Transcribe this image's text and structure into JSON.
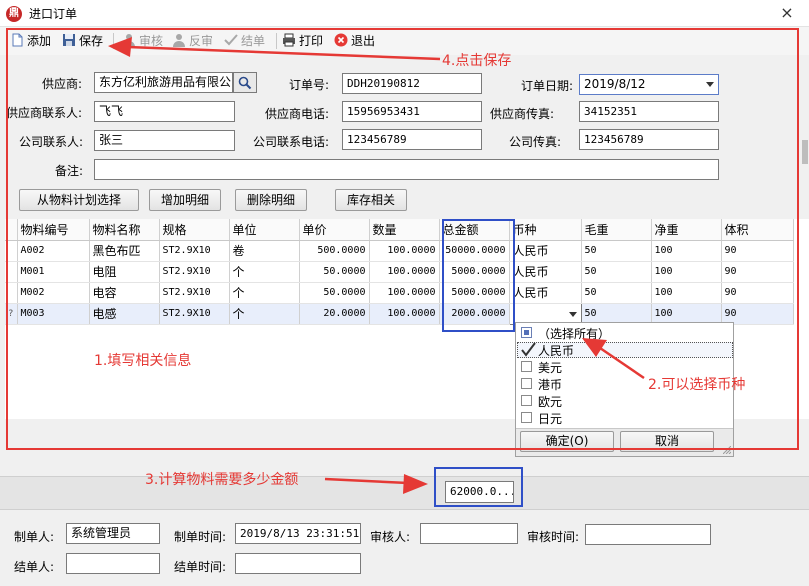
{
  "window": {
    "title": "进口订单",
    "close": "×",
    "app_icon": "鼎"
  },
  "toolbar": {
    "add": "添加",
    "save": "保存",
    "audit": "审核",
    "unaudit": "反审",
    "settle": "结单",
    "print": "打印",
    "exit": "退出"
  },
  "form": {
    "supplier_label": "供应商:",
    "supplier_value": "东方亿利旅游用品有限公司",
    "order_no_label": "订单号:",
    "order_no_value": "DDH20190812",
    "order_date_label": "订单日期:",
    "order_date_value": "2019/8/12",
    "supplier_contact_label": "供应商联系人:",
    "supplier_contact_value": "飞飞",
    "supplier_phone_label": "供应商电话:",
    "supplier_phone_value": "15956953431",
    "supplier_fax_label": "供应商传真:",
    "supplier_fax_value": "34152351",
    "company_contact_label": "公司联系人:",
    "company_contact_value": "张三",
    "company_phone_label": "公司联系电话:",
    "company_phone_value": "123456789",
    "company_fax_label": "公司传真:",
    "company_fax_value": "123456789",
    "remark_label": "备注:",
    "remark_value": ""
  },
  "buttons": {
    "from_plan": "从物料计划选择",
    "add_detail": "增加明细",
    "delete_detail": "删除明细",
    "stock": "库存相关"
  },
  "grid": {
    "columns": [
      "物料编号",
      "物料名称",
      "规格",
      "单位",
      "单价",
      "数量",
      "总金额",
      "币种",
      "毛重",
      "净重",
      "体积"
    ],
    "rows": [
      [
        "A002",
        "黑色布匹",
        "ST2.9X10",
        "卷",
        "500.0000",
        "100.0000",
        "50000.0000",
        "人民币",
        "50",
        "100",
        "90"
      ],
      [
        "M001",
        "电阻",
        "ST2.9X10",
        "个",
        "50.0000",
        "100.0000",
        "5000.0000",
        "人民币",
        "50",
        "100",
        "90"
      ],
      [
        "M002",
        "电容",
        "ST2.9X10",
        "个",
        "50.0000",
        "100.0000",
        "5000.0000",
        "人民币",
        "50",
        "100",
        "90"
      ],
      [
        "M003",
        "电感",
        "ST2.9X10",
        "个",
        "20.0000",
        "100.0000",
        "2000.0000",
        "",
        "50",
        "100",
        "90"
      ]
    ],
    "row_marker": "?"
  },
  "currency_popup": {
    "options": [
      "（选择所有）",
      "人民币",
      "美元",
      "港币",
      "欧元",
      "日元"
    ],
    "checked": "人民币",
    "ok": "确定(O)",
    "cancel": "取消"
  },
  "summary": {
    "total": "62000.0..."
  },
  "footer": {
    "creator_label": "制单人:",
    "creator_value": "系统管理员",
    "create_time_label": "制单时间:",
    "create_time_value": "2019/8/13 23:31:51",
    "auditor_label": "审核人:",
    "auditor_value": "",
    "audit_time_label": "审核时间:",
    "audit_time_value": "",
    "settler_label": "结单人:",
    "settler_value": "",
    "settle_time_label": "结单时间:",
    "settle_time_value": ""
  },
  "annotations": {
    "save_hint": "4.点击保存",
    "fill_hint": "1.填写相关信息",
    "currency_hint": "2.可以选择币种",
    "amount_hint": "3.计算物料需要多少金额"
  },
  "colors": {
    "annotation_red": "#e53935",
    "annotation_blue": "#2f4fc7"
  }
}
